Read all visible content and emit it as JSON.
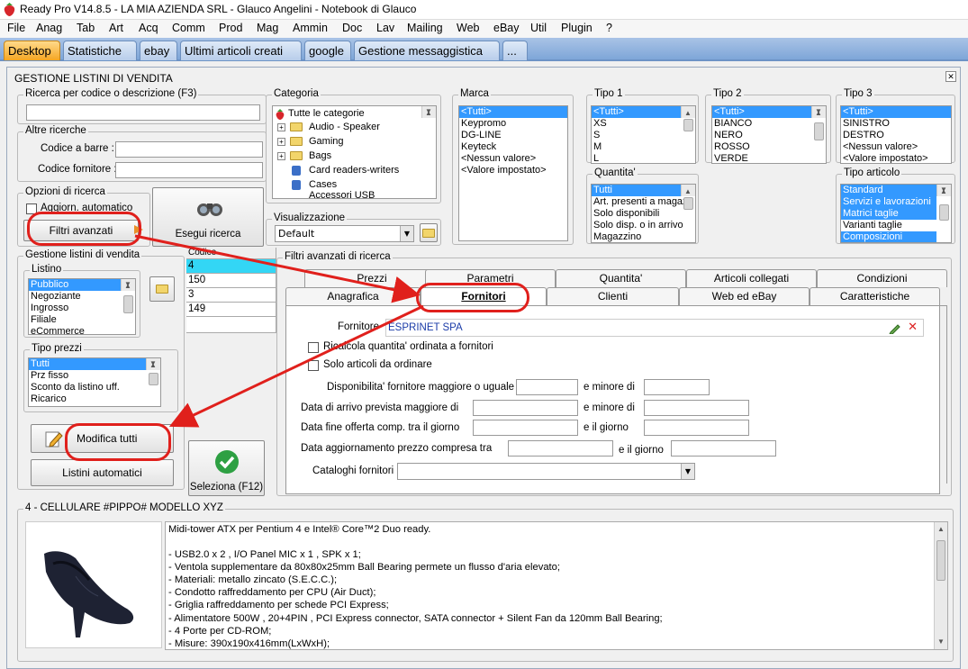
{
  "app": {
    "title": "Ready Pro V14.8.5 - LA MIA AZIENDA SRL - Glauco Angelini - Notebook di Glauco",
    "menu": [
      "File",
      "Anag",
      "Tab",
      "Art",
      "Acq",
      "Comm",
      "Prod",
      "Mag",
      "Ammin",
      "Doc",
      "Lav",
      "Mailing",
      "Web",
      "eBay",
      "Util",
      "Plugin",
      "?"
    ],
    "tabs": [
      "Desktop",
      "Statistiche",
      "ebay",
      "Ultimi articoli creati",
      "google",
      "Gestione messaggistica",
      "..."
    ]
  },
  "window": {
    "title": "GESTIONE LISTINI DI VENDITA",
    "close_glyph": "✕"
  },
  "search": {
    "legend": "Ricerca per codice o descrizione (F3)",
    "value": ""
  },
  "altre": {
    "legend": "Altre ricerche",
    "barcode_label": "Codice a barre :",
    "supplier_code_label": "Codice fornitore :"
  },
  "opzioni": {
    "legend": "Opzioni di ricerca",
    "auto_update_label": "Aggiorn. automatico",
    "advanced_filters_button": "Filtri avanzati",
    "search_button": "Esegui ricerca"
  },
  "categoria": {
    "legend": "Categoria",
    "items": [
      "Tutte le categorie",
      "Audio - Speaker",
      "Gaming",
      "Bags",
      "Card readers-writers",
      "Cases",
      "Accessori USB"
    ]
  },
  "visualizzazione": {
    "legend": "Visualizzazione",
    "value": "Default"
  },
  "marca": {
    "legend": "Marca",
    "items": [
      "<Tutti>",
      "Keypromo",
      "DG-LINE",
      "Keyteck",
      "<Nessun valore>",
      "<Valore impostato>"
    ],
    "selected": 0
  },
  "tipo1": {
    "legend": "Tipo 1",
    "items": [
      "<Tutti>",
      "XS",
      "S",
      "M",
      "L"
    ],
    "selected": 0
  },
  "tipo2": {
    "legend": "Tipo 2",
    "items": [
      "<Tutti>",
      "BIANCO",
      "NERO",
      "ROSSO",
      "VERDE"
    ],
    "selected": 0
  },
  "tipo3": {
    "legend": "Tipo 3",
    "items": [
      "<Tutti>",
      "SINISTRO",
      "DESTRO",
      "<Nessun valore>",
      "<Valore impostato>"
    ],
    "selected": 0
  },
  "quantita": {
    "legend": "Quantita'",
    "items": [
      "Tutti",
      "Art. presenti a magaz",
      "Solo disponibili",
      "Solo disp. o in arrivo",
      "Magazzino"
    ],
    "selected": 0
  },
  "tipo_articolo": {
    "legend": "Tipo articolo",
    "items": [
      "Standard",
      "Servizi e lavorazioni",
      "Matrici taglie",
      "Varianti taglie",
      "Composizioni"
    ],
    "selected": [
      0,
      1,
      2,
      4
    ]
  },
  "gestione": {
    "legend": "Gestione listini di vendita",
    "listino_legend": "Listino",
    "listino_items": [
      "Pubblico",
      "Negoziante",
      "Ingrosso",
      "Filiale",
      "eCommerce"
    ],
    "tipo_prezzi_legend": "Tipo prezzi",
    "tipo_prezzi_items": [
      "Tutti",
      "Prz fisso",
      "Sconto da listino uff.",
      "Ricarico"
    ],
    "modify_all_button": "Modifica tutti",
    "auto_lists_button": "Listini automatici",
    "select_button": "Seleziona (F12)"
  },
  "grid": {
    "header": "Codice",
    "rows": [
      "4",
      "150",
      "3",
      "149"
    ]
  },
  "filtri": {
    "legend": "Filtri avanzati di ricerca",
    "tabs_row1": [
      "Prezzi",
      "Parametri",
      "Quantita'",
      "Articoli collegati",
      "Condizioni"
    ],
    "tabs_row2": [
      "Anagrafica",
      "Fornitori",
      "Clienti",
      "Web ed eBay",
      "Caratteristiche"
    ],
    "active_tab": "Fornitori",
    "supplier_label": "Fornitore",
    "supplier_value": "ESPRINET SPA",
    "recalc_label": "Ricalcola quantita' ordinata a fornitori",
    "only_order_label": "Solo articoli da ordinare",
    "availability_label": "Disponibilita' fornitore maggiore o uguale a",
    "minor_label": "e minore di",
    "arrival_label": "Data di arrivo prevista maggiore di",
    "offer_end_label": "Data fine offerta comp. tra il giorno",
    "and_day_label": "e il giorno",
    "price_update_label": "Data aggiornamento prezzo compresa tra",
    "and_day_label2": "e il giorno",
    "catalog_label": "Cataloghi fornitori :"
  },
  "product": {
    "legend": "4 - CELLULARE #PIPPO# MODELLO XYZ",
    "lines": [
      "Midi-tower ATX per Pentium 4 e Intel® Core™2 Duo ready.",
      "",
      "- USB2.0 x 2 , I/O Panel MIC x 1 , SPK x 1;",
      "- Ventola supplementare da 80x80x25mm Ball Bearing permete un flusso d'aria elevato;",
      "- Materiali: metallo zincato (S.E.C.C.);",
      "- Condotto raffreddamento per CPU (Air Duct);",
      "- Griglia raffreddamento per schede PCI Express;",
      "- Alimentatore 500W , 20+4PIN , PCI Express connector, SATA connector + Silent Fan da 120mm Ball Bearing;",
      "- 4 Porte per CD-ROM;",
      "- Misure: 390x190x416mm(LxWxH);"
    ]
  },
  "colors": {
    "selection": "#3399ff",
    "annotation": "#e0201c",
    "active_tab": "#f5a623"
  }
}
